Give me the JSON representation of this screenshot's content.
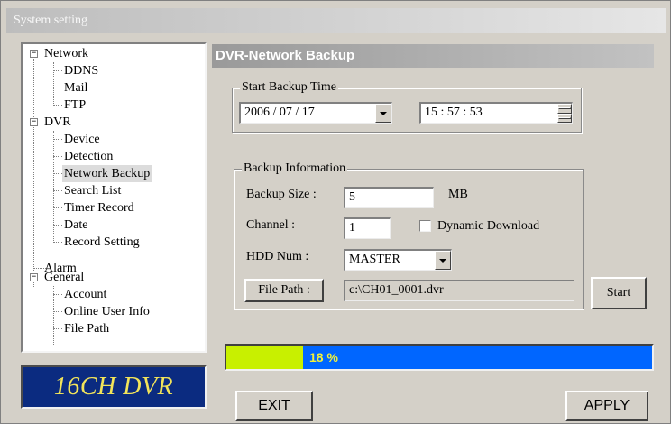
{
  "window": {
    "title": "System setting"
  },
  "tree": {
    "items": [
      {
        "label": "Network",
        "expander": "−"
      },
      {
        "label": "DDNS"
      },
      {
        "label": "Mail"
      },
      {
        "label": "FTP"
      },
      {
        "label": "DVR",
        "expander": "−"
      },
      {
        "label": "Device"
      },
      {
        "label": "Detection"
      },
      {
        "label": "Network Backup",
        "selected": true
      },
      {
        "label": "Search List"
      },
      {
        "label": "Timer Record"
      },
      {
        "label": "Date"
      },
      {
        "label": "Record Setting"
      },
      {
        "label": "Alarm"
      },
      {
        "label": "General",
        "expander": "−"
      },
      {
        "label": "Account"
      },
      {
        "label": "Online User Info"
      },
      {
        "label": "File Path"
      }
    ]
  },
  "logo": {
    "text": "16CH DVR",
    "color": "#f2e45a",
    "background": "#0b2b80"
  },
  "panel": {
    "title": "DVR-Network Backup"
  },
  "start_backup": {
    "group_label": "Start Backup Time",
    "date": "2006 / 07 / 17",
    "time": "15 : 57 : 53"
  },
  "backup_info": {
    "group_label": "Backup Information",
    "size_label": "Backup Size :",
    "size_value": "5",
    "size_unit": "MB",
    "channel_label": "Channel :",
    "channel_value": "1",
    "dynamic_download_label": "Dynamic Download",
    "dynamic_download_checked": false,
    "hdd_label": "HDD Num :",
    "hdd_value": "MASTER",
    "file_path_button": "File Path :",
    "file_path_value": "c:\\CH01_0001.dvr"
  },
  "start_button": "Start",
  "progress": {
    "percent": 18,
    "text": "18 %",
    "fill_color": "#c8f000",
    "bar_color": "#0066ff"
  },
  "footer": {
    "exit_label": "EXIT",
    "apply_label": "APPLY"
  }
}
